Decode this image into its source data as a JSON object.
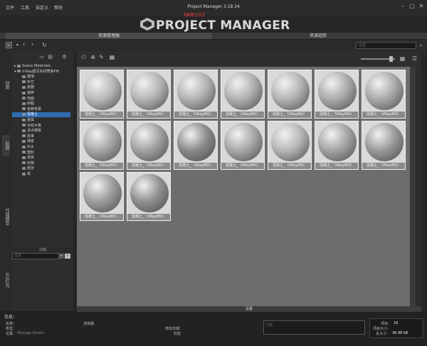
{
  "app": {
    "title": "Project Manager 3.18.34",
    "subtitle": "【幽猿汉化】",
    "logo_text": "PROJECT MANAGER"
  },
  "menu": [
    "文件",
    "工具",
    "自定义",
    "帮助"
  ],
  "window_controls": {
    "minimize": "–",
    "maximize": "□",
    "close": "✕"
  },
  "top_tabs": [
    "资源管理器",
    "资源追踪"
  ],
  "search": {
    "placeholder": "过滤"
  },
  "side_tabs": [
    "材质",
    "贴图",
    "代理模型",
    "IES灯光"
  ],
  "tree": {
    "items": [
      {
        "label": "Scene Materials",
        "selected": false,
        "indent": 0,
        "expander": "▸"
      },
      {
        "label": "V-Ray超写实材质库PM",
        "selected": false,
        "indent": 0,
        "expander": "▾"
      },
      {
        "label": "玻璃",
        "selected": false,
        "indent": 1
      },
      {
        "label": "布艺",
        "selected": false,
        "indent": 1
      },
      {
        "label": "瓷器",
        "selected": false,
        "indent": 1
      },
      {
        "label": "瓷砖",
        "selected": false,
        "indent": 1
      },
      {
        "label": "地面",
        "selected": false,
        "indent": 1
      },
      {
        "label": "树脂",
        "selected": false,
        "indent": 1
      },
      {
        "label": "各种背景",
        "selected": false,
        "indent": 1
      },
      {
        "label": "混凝土",
        "selected": true,
        "indent": 1
      },
      {
        "label": "金属",
        "selected": false,
        "indent": 1
      },
      {
        "label": "木纹木板",
        "selected": false,
        "indent": 1
      },
      {
        "label": "清水模板",
        "selected": false,
        "indent": 1
      },
      {
        "label": "皮革",
        "selected": false,
        "indent": 1
      },
      {
        "label": "墙纸",
        "selected": false,
        "indent": 1
      },
      {
        "label": "石头",
        "selected": false,
        "indent": 1
      },
      {
        "label": "塑料",
        "selected": false,
        "indent": 1
      },
      {
        "label": "液体",
        "selected": false,
        "indent": 1
      },
      {
        "label": "织物",
        "selected": false,
        "indent": 1
      },
      {
        "label": "纸张",
        "selected": false,
        "indent": 1
      },
      {
        "label": "其",
        "selected": false,
        "indent": 1
      }
    ],
    "bottom_label": "分组",
    "filter_placeholder": "过滤"
  },
  "materials": [
    {
      "label": "混凝土_（VRayMtl）",
      "tone": "#b9b9b9"
    },
    {
      "label": "混凝土_（VRayMtl）",
      "tone": "#b4b4b4"
    },
    {
      "label": "混凝土_（VRayMtl）",
      "tone": "#b2b2b2"
    },
    {
      "label": "混凝土_（VRayMtl）",
      "tone": "#b0b0b0"
    },
    {
      "label": "混凝土_（VRayMtl）",
      "tone": "#b3b3b3"
    },
    {
      "label": "混凝土_（VRayMtl）",
      "tone": "#aaaaaa"
    },
    {
      "label": "混凝土_（VRayMtl）",
      "tone": "#a9a9a9"
    },
    {
      "label": "混凝土_（VRayMtl）",
      "tone": "#a6a6a6"
    },
    {
      "label": "混凝土_（VRayMtl）",
      "tone": "#a1a1a1"
    },
    {
      "label": "混凝土_（VRayMtl）",
      "tone": "#8a8a8a"
    },
    {
      "label": "混凝土_（VRayMtl）",
      "tone": "#a8a8a8"
    },
    {
      "label": "混凝土_（VRayMtl）",
      "tone": "#b6b6b6"
    },
    {
      "label": "混凝土_（VRayMtl）",
      "tone": "#a3a3a3"
    },
    {
      "label": "混凝土_（VRayMtl）",
      "tone": "#9a9a9a"
    },
    {
      "label": "混凝土_（VRayMtl）",
      "tone": "#9c9c9c"
    },
    {
      "label": "混凝土_（VRayMtl）",
      "tone": "#8f8f8f"
    }
  ],
  "settings_label": "设置",
  "info": {
    "header": "信息：",
    "name_label": "名称：",
    "type_label": "类型：",
    "location_label": "位置：",
    "location_value": "Manage Assets",
    "renderer_label": "渲染器",
    "modified_label": "修改日期：",
    "size_label": "标签",
    "notes_placeholder": "注释",
    "stats": [
      {
        "label": "项目：",
        "value": "16"
      },
      {
        "label": "项目大小：",
        "value": ""
      },
      {
        "label": "总大小：",
        "value": "36.98 kB"
      }
    ]
  }
}
